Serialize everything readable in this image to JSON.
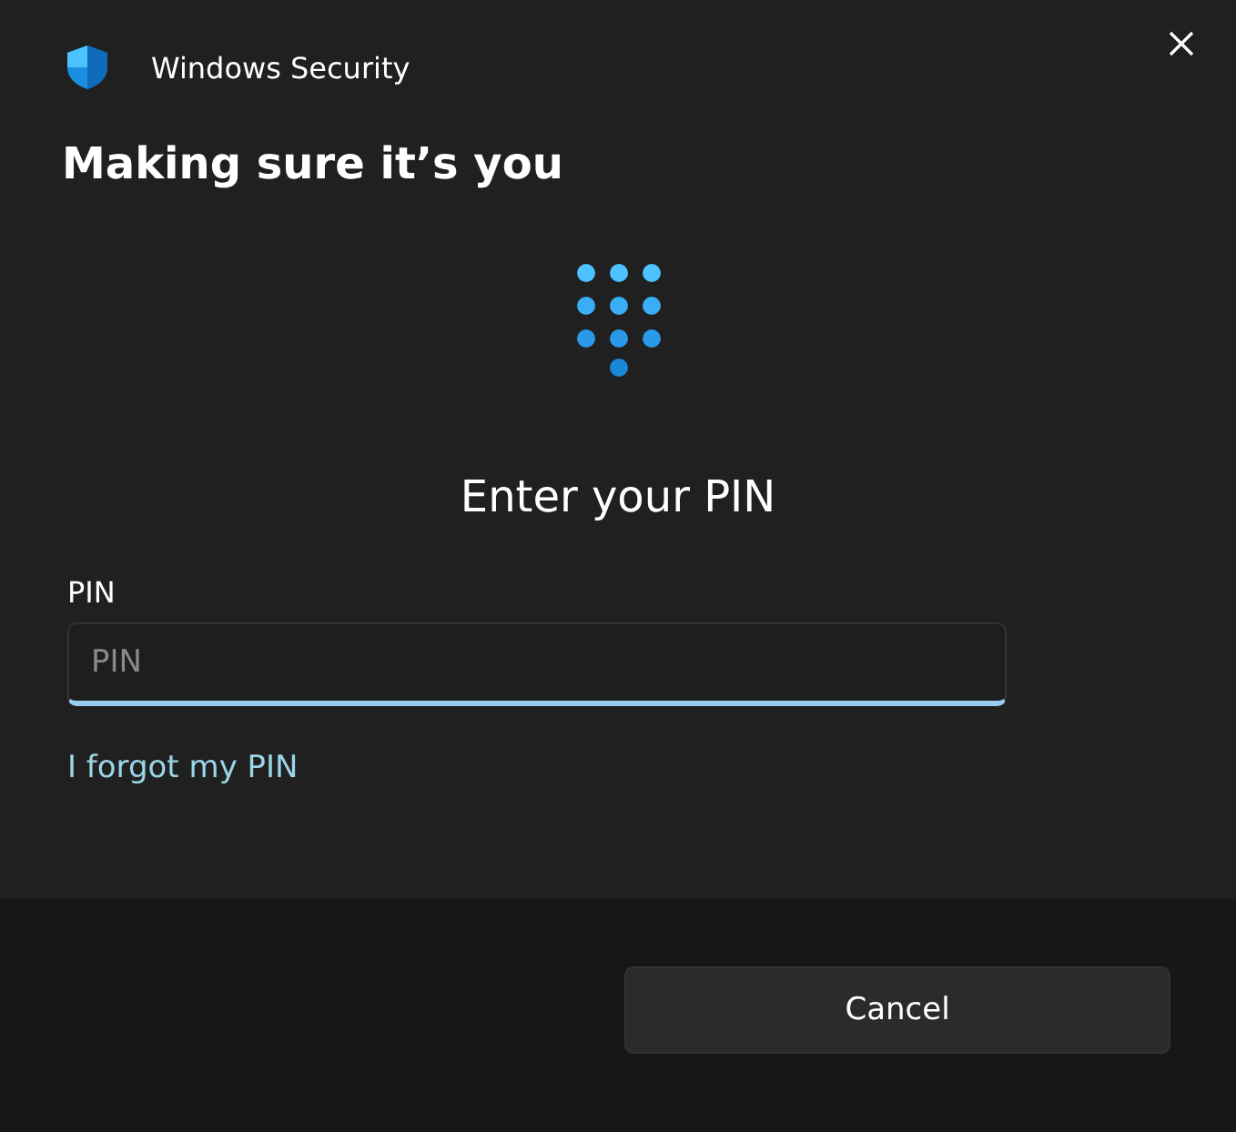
{
  "window": {
    "title": "Windows Security"
  },
  "heading": "Making sure it’s you",
  "prompt": "Enter your PIN",
  "pin_field": {
    "label": "PIN",
    "placeholder": "PIN",
    "focused": true
  },
  "link": "I forgot my PIN",
  "buttons": [
    "Cancel"
  ]
}
